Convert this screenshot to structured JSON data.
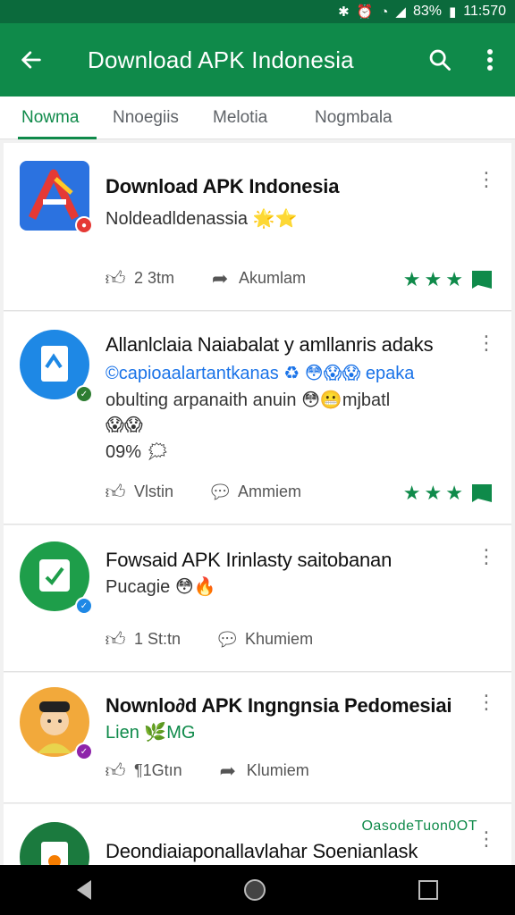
{
  "status_bar": {
    "battery": "83%",
    "time": "11:570"
  },
  "app_bar": {
    "title": "Download APK Indonesia"
  },
  "tabs": [
    {
      "label": "Nowma"
    },
    {
      "label": "Nnoegiis"
    },
    {
      "label": "Melotia"
    },
    {
      "label": "Nogmbala"
    }
  ],
  "feed": [
    {
      "title": "Download APK Indonesia",
      "lines": [
        "Noldeadldenassia 🌟⭐"
      ],
      "likes": "2 3tm",
      "share": "Akumlam",
      "stars": 3,
      "colors": {
        "avatar": "#2b72e0",
        "badge": "#e53935"
      }
    },
    {
      "title": "Allanlclaia Naiabalat y amllanris adaks",
      "lines": [
        "©capioaalartantkanas ♻ 😳😱😱 epaka",
        "obulting arpanaith anuin 😳😬mjbatl",
        "😱😱",
        "09% 🗯"
      ],
      "likes": "Vlstin",
      "share": "Ammiem",
      "stars": 3,
      "colors": {
        "avatar": "#1e88e5",
        "badge": "#2e7d32"
      }
    },
    {
      "title": "Fowsaid APK Irinlasty saitobanan",
      "lines": [
        "Pucagie 😳🔥"
      ],
      "likes": "1 St:tn",
      "share": "Khumiem",
      "colors": {
        "avatar": "#1e9e4a",
        "badge": "#1e88e5"
      }
    },
    {
      "title": "Nownlo∂d APK Ingngnsia Pedomesiai",
      "lines": [
        "Lien 🌿MG"
      ],
      "likes": "¶1Gtın",
      "share": "Klumiem",
      "colors": {
        "avatar": "#f2a93b",
        "badge": "#8e24aa"
      }
    },
    {
      "title": "Deondiaiaponallavlahar Soenianlask",
      "extra": "OasodeTuon0OT",
      "colors": {
        "avatar": "#1b7a3e"
      }
    }
  ]
}
